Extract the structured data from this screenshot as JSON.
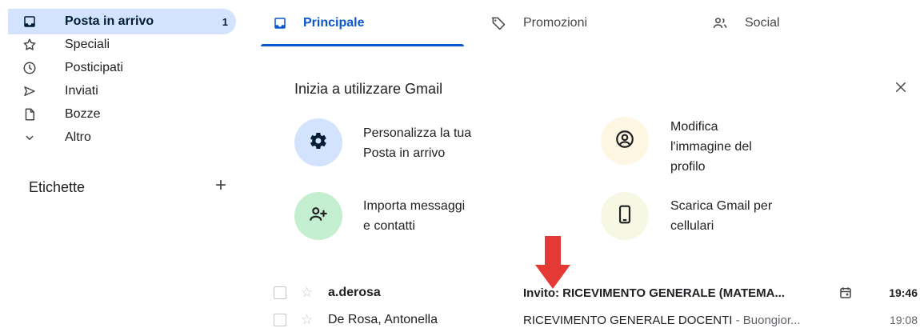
{
  "sidebar": {
    "items": [
      {
        "label": "Posta in arrivo",
        "count": "1",
        "icon": "inbox-icon"
      },
      {
        "label": "Speciali",
        "icon": "star-icon"
      },
      {
        "label": "Posticipati",
        "icon": "clock-icon"
      },
      {
        "label": "Inviati",
        "icon": "send-icon"
      },
      {
        "label": "Bozze",
        "icon": "draft-icon"
      },
      {
        "label": "Altro",
        "icon": "chevron-down-icon"
      }
    ],
    "labels_heading": "Etichette",
    "labels_add": "+"
  },
  "tabs": [
    {
      "label": "Principale",
      "icon": "inbox-icon",
      "active": true
    },
    {
      "label": "Promozioni",
      "icon": "tag-icon"
    },
    {
      "label": "Social",
      "icon": "people-icon"
    }
  ],
  "getting_started": {
    "title": "Inizia a utilizzare Gmail",
    "cards": [
      {
        "text": "Personalizza la tua\nPosta in arrivo",
        "icon": "gear-icon",
        "color": "#d3e3fd"
      },
      {
        "text": "Modifica\nl'immagine del\nprofilo",
        "icon": "account-circle-icon",
        "color": "#fdf6e3"
      },
      {
        "text": "Importa messaggi\ne contatti",
        "icon": "add-person-icon",
        "color": "#c4eed0"
      },
      {
        "text": "Scarica Gmail per\ncellulari",
        "icon": "phone-icon",
        "color": "#f7f8e4"
      }
    ]
  },
  "emails": [
    {
      "sender": "a.derosa",
      "subject": "Invito: RICEVIMENTO GENERALE (MATEMA...",
      "snippet": "",
      "time": "19:46",
      "unread": true,
      "has_calendar": true
    },
    {
      "sender": "De Rosa, Antonella",
      "subject": "RICEVIMENTO GENERALE DOCENTI",
      "snippet": " - Buongior...",
      "time": "19:08",
      "unread": false
    }
  ],
  "colors": {
    "accent": "#0b57d0",
    "active_nav": "#d3e3fd",
    "arrow": "#e53935"
  }
}
